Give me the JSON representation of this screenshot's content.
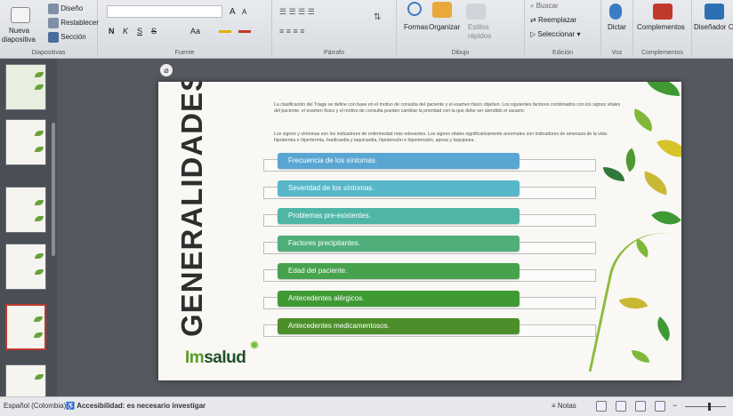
{
  "ribbon": {
    "diapositivas": {
      "new_slide": "Nueva",
      "new_slide2": "diapositiva",
      "diseno": "Diseño",
      "restablecer": "Restablecer",
      "seccion": "Sección",
      "group": "Diapositivas"
    },
    "fuente": {
      "group": "Fuente",
      "bold": "N",
      "italic": "K",
      "underline": "S",
      "strike": "S",
      "grow": "A",
      "shrink": "A",
      "case": "Aa"
    },
    "parrafo": {
      "group": "Párrafo"
    },
    "dibujo": {
      "formas": "Formas",
      "organizar": "Organizar",
      "estilos": "Estilos",
      "estilos2": "rápidos",
      "group": "Dibujo"
    },
    "edicion": {
      "buscar": "Buscar",
      "reemplazar": "Reemplazar",
      "seleccionar": "Seleccionar",
      "group": "Edición"
    },
    "voz": {
      "dictar": "Dictar",
      "group": "Voz"
    },
    "complementos": {
      "label": "Complementos",
      "group": "Complementos"
    },
    "disenador": {
      "label": "Diseñador C"
    }
  },
  "slide": {
    "title": "GENERALIDADES",
    "paragraph1": "La clasificación del Triage se define con base en el motivo de consulta del paciente y el examen físico objetivo. Los siguientes factores combinados con los signos vitales del paciente, el examen físico y el motivo de consulta pueden cambiar la prioridad con la que debe ser atendido el usuario:",
    "paragraph2": "Los signos y síntomas son los indicadores de enfermedad más relevantes. Los signos vitales significativamente anormales son indicadores de amenaza de la vida: hipotermia e hipertermia, bradicardia y taquicardia, hipotensión e hipertensión, apnea y taquipnea.",
    "items": [
      {
        "label": "Frecuencia de los síntomas.",
        "color": "#5aa6d3"
      },
      {
        "label": "Severidad de los síntomas.",
        "color": "#57b7c9"
      },
      {
        "label": "Problemas pre-existentes.",
        "color": "#4fb6a6"
      },
      {
        "label": "Factores precipitantes.",
        "color": "#4fae7a"
      },
      {
        "label": "Edad del paciente.",
        "color": "#46a24d"
      },
      {
        "label": "Antecedentes alérgicos.",
        "color": "#3f9a34"
      },
      {
        "label": "Antecedentes medicamentosos.",
        "color": "#4c8f2a"
      }
    ],
    "logo_a": "Im",
    "logo_b": "salud"
  },
  "status": {
    "language": "Español (Colombia)",
    "accessibility": "Accesibilidad: es necesario investigar",
    "notes": "Notas"
  },
  "colors": {
    "ribbon": "#e1e4e8",
    "slide_bg": "#f9f8f4",
    "brand_green": "#5a9a2a"
  }
}
